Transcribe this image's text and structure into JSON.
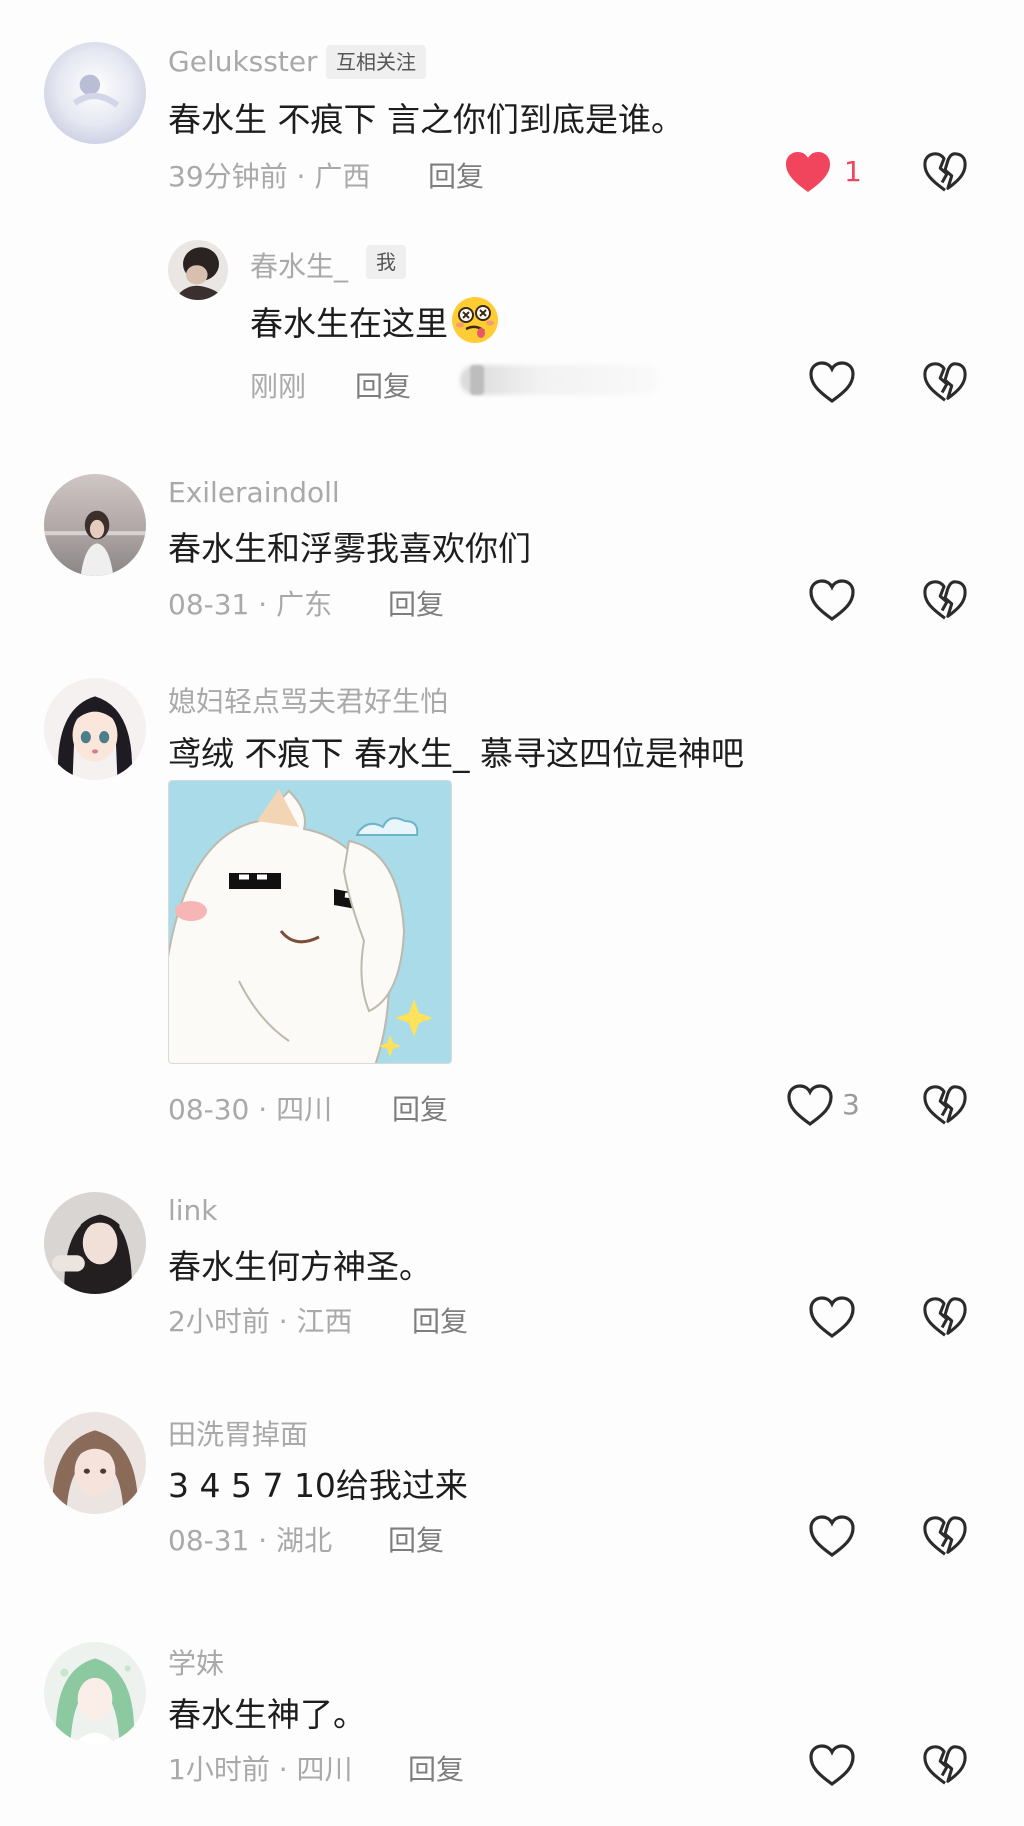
{
  "comments": [
    {
      "username": "Geluksster",
      "tag": "互相关注",
      "text": "春水生 不痕下 言之你们到底是谁。",
      "time": "39分钟前 · 广西",
      "reply": "回复",
      "like_count": "1",
      "liked": true
    },
    {
      "username": "春水生_",
      "tag": "我",
      "text": "春水生在这里",
      "time": "刚刚",
      "reply": "回复",
      "emoji": "woozy-face-emoji"
    },
    {
      "username": "Exileraindoll",
      "text": "春水生和浮雾我喜欢你们",
      "time": "08-31 · 广东",
      "reply": "回复"
    },
    {
      "username": "媳妇轻点骂夫君好生怕",
      "text": "鸢绒 不痕下 春水生_ 慕寻这四位是神吧",
      "time": "08-30 · 四川",
      "reply": "回复",
      "like_count": "3",
      "sticker": "shy-cat-sticker"
    },
    {
      "username": "link",
      "text": "春水生何方神圣。",
      "time": "2小时前 · 江西",
      "reply": "回复"
    },
    {
      "username": "田洗胃掉面",
      "text": "3 4 5 7 10给我过来",
      "time": "08-31 · 湖北",
      "reply": "回复"
    },
    {
      "username": "学妹",
      "text": "春水生神了。",
      "time": "1小时前 · 四川",
      "reply": "回复"
    }
  ],
  "colors": {
    "liked": "#f0455d",
    "icon": "#2b2b2b",
    "meta": "#a9a9a9"
  },
  "icons": [
    "heart-icon",
    "heart-filled-icon",
    "broken-heart-icon"
  ]
}
